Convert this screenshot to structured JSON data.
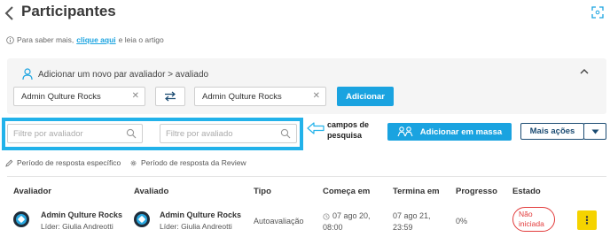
{
  "header": {
    "title": "Participantes"
  },
  "info": {
    "prefix": "Para saber mais, ",
    "link": "clique aqui",
    "suffix": " e leia o artigo"
  },
  "add_panel": {
    "title": "Adicionar um novo par avaliador > avaliado",
    "evaluator_value": "Admin Qulture Rocks",
    "evaluated_value": "Admin Qulture Rocks",
    "add_button": "Adicionar"
  },
  "filters": {
    "evaluator_placeholder": "Filtre por avaliador",
    "evaluated_placeholder": "Filtre por avaliado"
  },
  "annotation": {
    "line1": "campos de",
    "line2": "pesquisa"
  },
  "actions": {
    "mass_add": "Adicionar em massa",
    "more": "Mais ações"
  },
  "periods": {
    "specific": "Período de resposta específico",
    "review": "Período de resposta da Review"
  },
  "table": {
    "headers": {
      "evaluator": "Avaliador",
      "evaluated": "Avaliado",
      "type": "Tipo",
      "start": "Começa em",
      "end": "Termina em",
      "progress": "Progresso",
      "status": "Estado"
    },
    "rows": [
      {
        "evaluator_name": "Admin Qulture Rocks",
        "evaluator_leader": "Líder: Giulia Andreotti",
        "evaluated_name": "Admin Qulture Rocks",
        "evaluated_leader": "Líder: Giulia Andreotti",
        "type": "Autoavaliação",
        "start_line1": "07 ago 20,",
        "start_line2": "08:00",
        "end_line1": "07 ago 21,",
        "end_line2": "23:59",
        "progress": "0%",
        "status_line1": "Não",
        "status_line2": "iniciada"
      }
    ]
  },
  "colors": {
    "accent": "#1aa3e0",
    "highlight": "#22b2ea",
    "dark_button": "#1b4b72",
    "status_red": "#e23b3b",
    "menu_yellow": "#f5d300"
  },
  "icons": [
    "back-chevron-icon",
    "expand-icon",
    "info-icon",
    "user-icon",
    "chevron-up-icon",
    "clear-icon",
    "swap-icon",
    "search-icon",
    "arrow-left-icon",
    "group-icon",
    "chevron-down-icon",
    "pencil-icon",
    "gear-icon",
    "avatar-logo-icon",
    "clock-icon",
    "more-vertical-icon"
  ]
}
